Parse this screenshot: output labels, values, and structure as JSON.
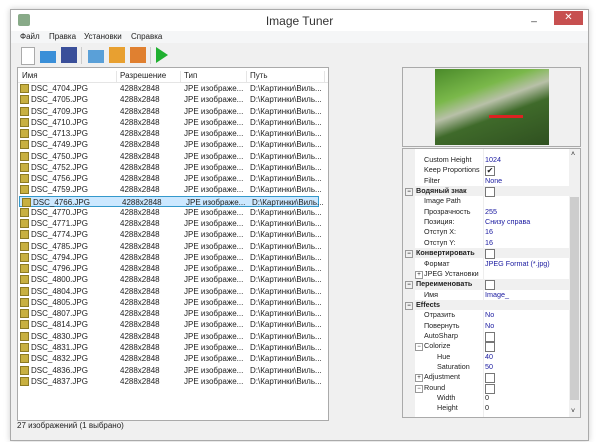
{
  "title": "Image Tuner",
  "menu": [
    "Файл",
    "Правка",
    "Установки",
    "Справка"
  ],
  "toolbar": [
    "new-icon",
    "open-folder-icon",
    "save-icon",
    "add-folder-icon",
    "add-image-icon",
    "remove-image-icon",
    "run-icon"
  ],
  "columns": [
    "Имя",
    "Разрешение",
    "Тип",
    "Путь"
  ],
  "files": [
    {
      "name": "DSC_4704.JPG",
      "res": "4288x2848",
      "type": "JPE изображе...",
      "path": "D:\\Картинки\\Виль..."
    },
    {
      "name": "DSC_4705.JPG",
      "res": "4288x2848",
      "type": "JPE изображе...",
      "path": "D:\\Картинки\\Виль..."
    },
    {
      "name": "DSC_4709.JPG",
      "res": "4288x2848",
      "type": "JPE изображе...",
      "path": "D:\\Картинки\\Виль..."
    },
    {
      "name": "DSC_4710.JPG",
      "res": "4288x2848",
      "type": "JPE изображе...",
      "path": "D:\\Картинки\\Виль..."
    },
    {
      "name": "DSC_4713.JPG",
      "res": "4288x2848",
      "type": "JPE изображе...",
      "path": "D:\\Картинки\\Виль..."
    },
    {
      "name": "DSC_4749.JPG",
      "res": "4288x2848",
      "type": "JPE изображе...",
      "path": "D:\\Картинки\\Виль..."
    },
    {
      "name": "DSC_4750.JPG",
      "res": "4288x2848",
      "type": "JPE изображе...",
      "path": "D:\\Картинки\\Виль..."
    },
    {
      "name": "DSC_4752.JPG",
      "res": "4288x2848",
      "type": "JPE изображе...",
      "path": "D:\\Картинки\\Виль..."
    },
    {
      "name": "DSC_4756.JPG",
      "res": "4288x2848",
      "type": "JPE изображе...",
      "path": "D:\\Картинки\\Виль..."
    },
    {
      "name": "DSC_4759.JPG",
      "res": "4288x2848",
      "type": "JPE изображе...",
      "path": "D:\\Картинки\\Виль..."
    },
    {
      "name": "DSC_4766.JPG",
      "res": "4288x2848",
      "type": "JPE изображе...",
      "path": "D:\\Картинки\\Виль...",
      "selected": true
    },
    {
      "name": "DSC_4770.JPG",
      "res": "4288x2848",
      "type": "JPE изображе...",
      "path": "D:\\Картинки\\Виль..."
    },
    {
      "name": "DSC_4771.JPG",
      "res": "4288x2848",
      "type": "JPE изображе...",
      "path": "D:\\Картинки\\Виль..."
    },
    {
      "name": "DSC_4774.JPG",
      "res": "4288x2848",
      "type": "JPE изображе...",
      "path": "D:\\Картинки\\Виль..."
    },
    {
      "name": "DSC_4785.JPG",
      "res": "4288x2848",
      "type": "JPE изображе...",
      "path": "D:\\Картинки\\Виль..."
    },
    {
      "name": "DSC_4794.JPG",
      "res": "4288x2848",
      "type": "JPE изображе...",
      "path": "D:\\Картинки\\Виль..."
    },
    {
      "name": "DSC_4796.JPG",
      "res": "4288x2848",
      "type": "JPE изображе...",
      "path": "D:\\Картинки\\Виль..."
    },
    {
      "name": "DSC_4800.JPG",
      "res": "4288x2848",
      "type": "JPE изображе...",
      "path": "D:\\Картинки\\Виль..."
    },
    {
      "name": "DSC_4804.JPG",
      "res": "4288x2848",
      "type": "JPE изображе...",
      "path": "D:\\Картинки\\Виль..."
    },
    {
      "name": "DSC_4805.JPG",
      "res": "4288x2848",
      "type": "JPE изображе...",
      "path": "D:\\Картинки\\Виль..."
    },
    {
      "name": "DSC_4807.JPG",
      "res": "4288x2848",
      "type": "JPE изображе...",
      "path": "D:\\Картинки\\Виль..."
    },
    {
      "name": "DSC_4814.JPG",
      "res": "4288x2848",
      "type": "JPE изображе...",
      "path": "D:\\Картинки\\Виль..."
    },
    {
      "name": "DSC_4830.JPG",
      "res": "4288x2848",
      "type": "JPE изображе...",
      "path": "D:\\Картинки\\Виль..."
    },
    {
      "name": "DSC_4831.JPG",
      "res": "4288x2848",
      "type": "JPE изображе...",
      "path": "D:\\Картинки\\Виль..."
    },
    {
      "name": "DSC_4832.JPG",
      "res": "4288x2848",
      "type": "JPE изображе...",
      "path": "D:\\Картинки\\Виль..."
    },
    {
      "name": "DSC_4836.JPG",
      "res": "4288x2848",
      "type": "JPE изображе...",
      "path": "D:\\Картинки\\Виль..."
    },
    {
      "name": "DSC_4837.JPG",
      "res": "4288x2848",
      "type": "JPE изображе...",
      "path": "D:\\Картинки\\Виль..."
    }
  ],
  "status": "27 изображений (1 выбрано)",
  "properties": [
    {
      "name": "Custom Height",
      "value": "1024",
      "level": 1
    },
    {
      "name": "Keep Proportions",
      "check": true,
      "level": 1
    },
    {
      "name": "Filter",
      "value": "None",
      "level": 1
    },
    {
      "name": "Водяный знак",
      "check": false,
      "cat": true,
      "exp": "−"
    },
    {
      "name": "Image Path",
      "value": "",
      "level": 1
    },
    {
      "name": "Прозрачность",
      "value": "255",
      "level": 1
    },
    {
      "name": "Позиция:",
      "value": "Снизу справа",
      "level": 1
    },
    {
      "name": "Отступ X:",
      "value": "16",
      "level": 1
    },
    {
      "name": "Отступ Y:",
      "value": "16",
      "level": 1
    },
    {
      "name": "Конвертировать",
      "check": false,
      "cat": true,
      "exp": "−"
    },
    {
      "name": "Формат",
      "value": "JPEG Format (*.jpg)",
      "level": 1
    },
    {
      "name": "JPEG Установки",
      "level": 1,
      "exp": "+"
    },
    {
      "name": "Переименовать",
      "check": false,
      "cat": true,
      "exp": "−"
    },
    {
      "name": "Имя",
      "value": "Image_",
      "level": 1
    },
    {
      "name": "Effects",
      "cat": true,
      "exp": "−"
    },
    {
      "name": "Отразить",
      "value": "No",
      "level": 1
    },
    {
      "name": "Повернуть",
      "value": "No",
      "level": 1
    },
    {
      "name": "AutoSharp",
      "check": false,
      "level": 1
    },
    {
      "name": "Colorize",
      "check": false,
      "level": 1,
      "exp": "−"
    },
    {
      "name": "Hue",
      "value": "40",
      "level": 2
    },
    {
      "name": "Saturation",
      "value": "50",
      "level": 2
    },
    {
      "name": "Adjustment",
      "check": false,
      "level": 1,
      "exp": "+"
    },
    {
      "name": "Round",
      "check": false,
      "level": 1,
      "exp": "−"
    },
    {
      "name": "Width",
      "value": "0",
      "level": 2,
      "plain": true
    },
    {
      "name": "Height",
      "value": "0",
      "level": 2,
      "plain": true
    }
  ]
}
